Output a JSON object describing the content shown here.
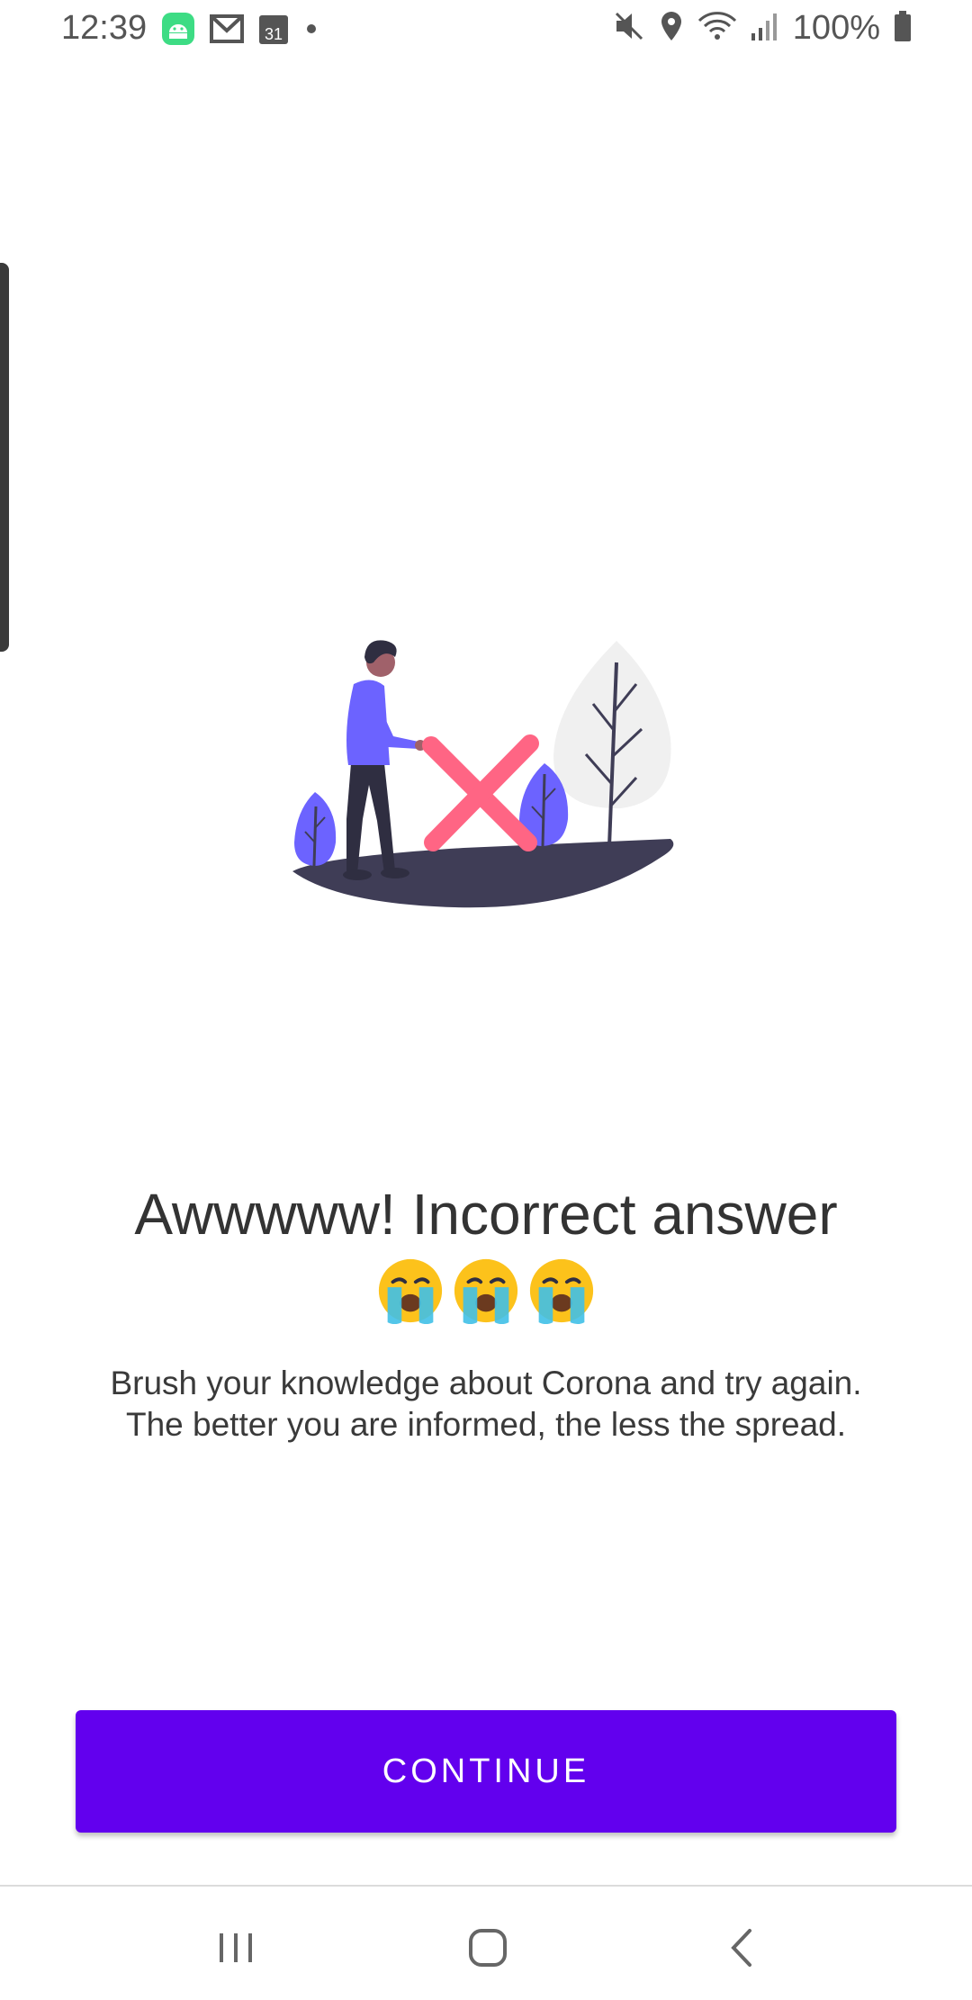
{
  "status_bar": {
    "time": "12:39",
    "left_icons": [
      "android-icon",
      "gmail-icon",
      "calendar-icon",
      "dot-icon"
    ],
    "calendar_day": "31",
    "right_icons": [
      "mute-icon",
      "location-icon",
      "wifi-icon",
      "signal-icon",
      "battery-icon"
    ],
    "battery": "100%"
  },
  "content": {
    "title": "Awwwww! Incorrect answer",
    "emojis": [
      "crying-face-icon",
      "crying-face-icon",
      "crying-face-icon"
    ],
    "message_line1": "Brush your knowledge about Corona and try again.",
    "message_line2": "The better you are informed, the less the spread."
  },
  "actions": {
    "continue_label": "CONTINUE"
  },
  "nav": {
    "icons": [
      "recents-icon",
      "home-icon",
      "back-icon"
    ]
  },
  "colors": {
    "accent": "#6200ee",
    "figure_shirt": "#6c63ff",
    "cross": "#ff6584",
    "ground": "#3f3d56",
    "tree_light": "#f0f0f0"
  }
}
